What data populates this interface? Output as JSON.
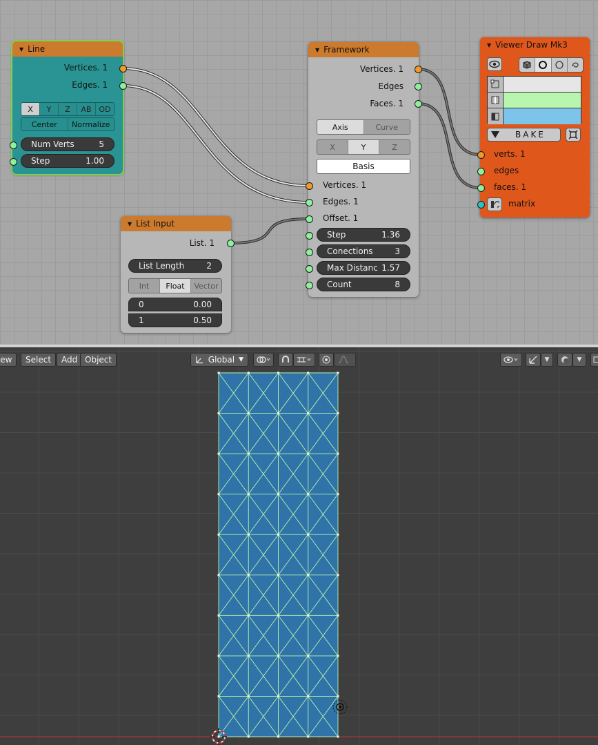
{
  "nodes": {
    "line": {
      "title": "Line",
      "out_vertices": "Vertices. 1",
      "out_edges": "Edges. 1",
      "dir_buttons": [
        "X",
        "Y",
        "Z",
        "AB",
        "OD"
      ],
      "dir_selected": "X",
      "mode_buttons": [
        "Center",
        "Normalize"
      ],
      "num_verts_label": "Num Verts",
      "num_verts_value": "5",
      "step_label": "Step",
      "step_value": "1.00"
    },
    "framework": {
      "title": "Framework",
      "out_vertices": "Vertices. 1",
      "out_edges": "Edges",
      "out_faces": "Faces. 1",
      "mode_buttons": [
        "Axis",
        "Curve"
      ],
      "mode_selected": "Axis",
      "axis_buttons": [
        "X",
        "Y",
        "Z"
      ],
      "axis_selected": "Y",
      "basis_label": "Basis",
      "in_vertices": "Vertices. 1",
      "in_edges": "Edges. 1",
      "in_offset": "Offset. 1",
      "step_label": "Step",
      "step_value": "1.36",
      "conections_label": "Conections",
      "conections_value": "3",
      "max_dist_label": "Max Distanc",
      "max_dist_value": "1.57",
      "count_label": "Count",
      "count_value": "8"
    },
    "list_input": {
      "title": "List Input",
      "out_list": "List. 1",
      "list_length_label": "List Length",
      "list_length_value": "2",
      "type_buttons": [
        "Int",
        "Float",
        "Vector"
      ],
      "type_selected": "Float",
      "items": [
        {
          "index": "0",
          "value": "0.00"
        },
        {
          "index": "1",
          "value": "0.50"
        }
      ]
    },
    "viewer": {
      "title": "Viewer Draw Mk3",
      "bake_label": "BAKE",
      "in_verts": "verts. 1",
      "in_edges": "edges",
      "in_faces": "faces. 1",
      "in_matrix": "matrix",
      "colors": {
        "vertex": "#e6e6e6",
        "edge": "#b8f5ae",
        "face": "#7cc4ea"
      }
    }
  },
  "viewport_header": {
    "view_label": "View",
    "select_label": "Select",
    "add_label": "Add",
    "object_label": "Object",
    "orientation_label": "Global"
  },
  "mesh": {
    "columns": 4,
    "rows": 9,
    "face_color": "#2f73a8",
    "wire_color": "#b8f5ae"
  },
  "colors": {
    "node_editor_bg": "#a7a7a7",
    "node_header": "#cc7a2e",
    "line_node_body": "#2a9393",
    "viewer_node_body": "#e0571c",
    "vertex_socket": "#ef9a2a",
    "generic_socket": "#8ef09a",
    "matrix_socket": "#27c3c9",
    "viewport_bg": "#3e3e3e"
  }
}
